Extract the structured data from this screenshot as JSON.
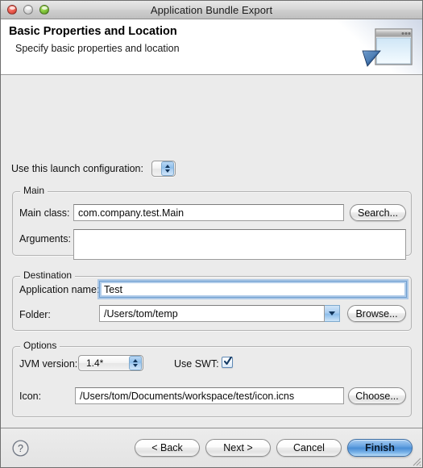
{
  "window": {
    "title": "Application Bundle Export",
    "traffic_lights": [
      {
        "name": "close",
        "color": "#ef5f52",
        "enabled": true
      },
      {
        "name": "minimize",
        "color": "#dcdcdc",
        "enabled": false
      },
      {
        "name": "zoom",
        "color": "#84c93d",
        "enabled": true
      }
    ]
  },
  "banner": {
    "title": "Basic Properties and Location",
    "subtitle": "Specify basic properties and location",
    "icon": "export-window-icon"
  },
  "launch": {
    "label": "Use this launch configuration:",
    "value": "",
    "control": "popup-stepper"
  },
  "groups": {
    "main": {
      "title": "Main",
      "fields": [
        {
          "label": "Main class:",
          "value": "com.company.test.Main",
          "placeholder": ""
        },
        {
          "label": "Arguments:",
          "value": "",
          "placeholder": ""
        }
      ],
      "button": "Search..."
    },
    "destination": {
      "title": "Destination",
      "app_name": {
        "label": "Application name:",
        "value": "Test",
        "placeholder": "",
        "focused": true
      },
      "folder": {
        "label": "Folder:",
        "value": "/Users/tom/temp",
        "placeholder": ""
      },
      "button": "Browse..."
    },
    "options": {
      "title": "Options",
      "jvm": {
        "label": "JVM version:",
        "value": "1.4*"
      },
      "swt": {
        "label": "Use SWT:",
        "checked": true
      },
      "icon": {
        "label": "Icon:",
        "value": "/Users/tom/Documents/workspace/test/icon.icns",
        "placeholder": ""
      },
      "button": "Choose..."
    }
  },
  "footer": {
    "help": "?",
    "back": "< Back",
    "next": "Next >",
    "cancel": "Cancel",
    "finish": "Finish"
  },
  "colors": {
    "accent": "#4a8ed6",
    "window_bg": "#ebebeb",
    "banner_bg": "#ffffff",
    "border": "#b3b3b3"
  }
}
